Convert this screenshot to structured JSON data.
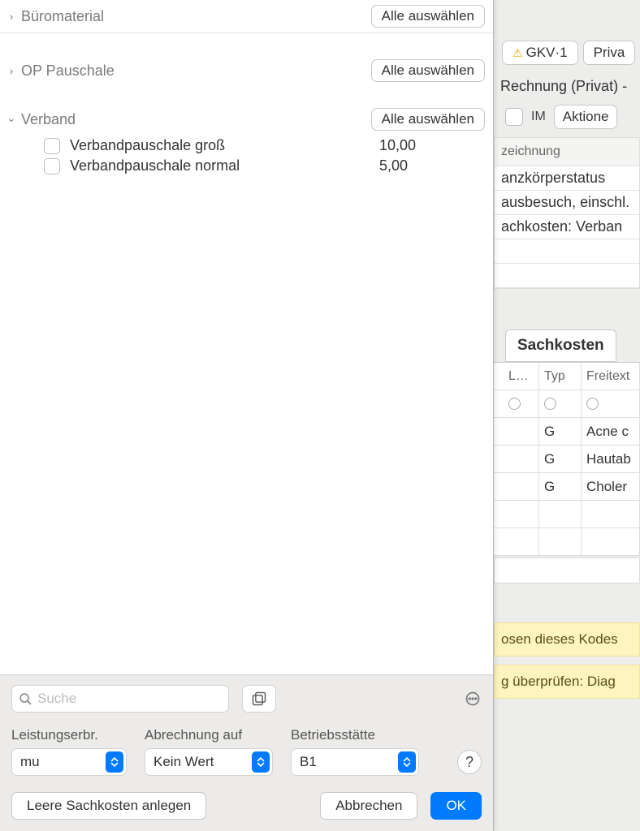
{
  "categories": [
    {
      "label": "Büromaterial",
      "select_all": "Alle auswählen",
      "expanded": false
    },
    {
      "label": "OP Pauschale",
      "select_all": "Alle auswählen",
      "expanded": false
    },
    {
      "label": "Verband",
      "select_all": "Alle auswählen",
      "expanded": true,
      "items": [
        {
          "label": "Verbandpauschale groß",
          "price": "10,00"
        },
        {
          "label": "Verbandpauschale normal",
          "price": "5,00"
        }
      ]
    }
  ],
  "search": {
    "placeholder": "Suche"
  },
  "fields": {
    "leistungserbr_label": "Leistungserbr.",
    "leistungserbr_value": "mu",
    "abrechnung_label": "Abrechnung auf",
    "abrechnung_value": "Kein Wert",
    "betriebs_label": "Betriebsstätte",
    "betriebs_value": "B1"
  },
  "buttons": {
    "help": "?",
    "leere": "Leere Sachkosten anlegen",
    "abbrechen": "Abbrechen",
    "ok": "OK"
  },
  "bg": {
    "tab_gkv": "GKV·1",
    "tab_priv": "Priva",
    "title": "Rechnung (Privat) -",
    "im": "IM",
    "aktionen": "Aktione",
    "header_zeichnung": "zeichnung",
    "rows": [
      "anzkörperstatus",
      "ausbesuch, einschl.",
      "achkosten: Verban"
    ],
    "sachkosten_tab": "Sachkosten",
    "table": {
      "headers": {
        "l": "L…",
        "typ": "Typ",
        "frei": "Freitext"
      },
      "rows": [
        {
          "typ": "G",
          "frei": "Acne c"
        },
        {
          "typ": "G",
          "frei": "Hautab"
        },
        {
          "typ": "G",
          "frei": "Choler"
        }
      ]
    },
    "warn1": "osen dieses Kodes",
    "warn2": "g überprüfen: Diag"
  }
}
